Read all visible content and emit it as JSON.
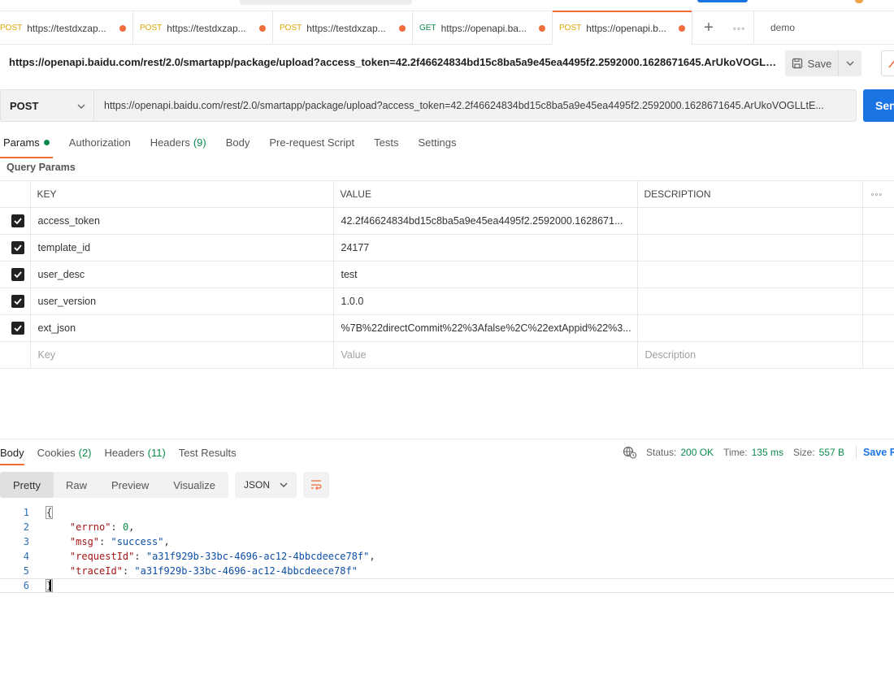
{
  "tabs": [
    {
      "method": "POST",
      "url": "https://testdxzap...",
      "active": false
    },
    {
      "method": "POST",
      "url": "https://testdxzap...",
      "active": false
    },
    {
      "method": "POST",
      "url": "https://testdxzap...",
      "active": false
    },
    {
      "method": "GET",
      "url": "https://openapi.ba...",
      "active": false
    },
    {
      "method": "POST",
      "url": "https://openapi.b...",
      "active": true
    }
  ],
  "environment": "demo",
  "request": {
    "title_url": "https://openapi.baidu.com/rest/2.0/smartapp/package/upload?access_token=42.2f46624834bd15c8ba5a9e45ea4495f2.2592000.1628671645.ArUkoVOGLLtE...",
    "method": "POST",
    "url": "https://openapi.baidu.com/rest/2.0/smartapp/package/upload?access_token=42.2f46624834bd15c8ba5a9e45ea4495f2.2592000.1628671645.ArUkoVOGLLtE...",
    "save_label": "Save",
    "send_label": "Send"
  },
  "request_tabs": [
    {
      "label": "Params",
      "count": "",
      "active": true
    },
    {
      "label": "Authorization",
      "count": ""
    },
    {
      "label": "Headers",
      "count": "(9)"
    },
    {
      "label": "Body",
      "count": ""
    },
    {
      "label": "Pre-request Script",
      "count": ""
    },
    {
      "label": "Tests",
      "count": ""
    },
    {
      "label": "Settings",
      "count": ""
    }
  ],
  "query_params": {
    "label": "Query Params",
    "columns": [
      "KEY",
      "VALUE",
      "DESCRIPTION"
    ],
    "rows": [
      {
        "key": "access_token",
        "value": "42.2f46624834bd15c8ba5a9e45ea4495f2.2592000.1628671...",
        "checked": true
      },
      {
        "key": "template_id",
        "value": "24177",
        "checked": true
      },
      {
        "key": "user_desc",
        "value": "test",
        "checked": true
      },
      {
        "key": "user_version",
        "value": "1.0.0",
        "checked": true
      },
      {
        "key": "ext_json",
        "value": "%7B%22directCommit%22%3Afalse%2C%22extAppid%22%3...",
        "checked": true
      }
    ],
    "placeholders": {
      "key": "Key",
      "value": "Value",
      "description": "Description"
    }
  },
  "response_tabs": [
    {
      "label": "Body",
      "count": "",
      "active": true
    },
    {
      "label": "Cookies",
      "count": "(2)"
    },
    {
      "label": "Headers",
      "count": "(11)"
    },
    {
      "label": "Test Results",
      "count": ""
    }
  ],
  "status": {
    "status_label": "Status:",
    "status_value": "200 OK",
    "time_label": "Time:",
    "time_value": "135 ms",
    "size_label": "Size:",
    "size_value": "557 B",
    "save_response": "Save Res"
  },
  "view_modes": [
    "Pretty",
    "Raw",
    "Preview",
    "Visualize"
  ],
  "format": "JSON",
  "code_lines": [
    "1",
    "2",
    "3",
    "4",
    "5",
    "6"
  ],
  "response_body": {
    "errno_key": "\"errno\"",
    "errno_value": "0",
    "msg_key": "\"msg\"",
    "msg_value": "\"success\"",
    "requestId_key": "\"requestId\"",
    "requestId_value": "\"a31f929b-33bc-4696-ac12-4bbcdeece78f\"",
    "traceId_key": "\"traceId\"",
    "traceId_value": "\"a31f929b-33bc-4696-ac12-4bbcdeece78f\"",
    "open_brace": "{",
    "close_brace": "}"
  },
  "colors": {
    "accent": "#f26b3a",
    "send_blue": "#1b74e4",
    "ok_green": "#0a8a4b",
    "post_yellow": "#e2a400"
  }
}
